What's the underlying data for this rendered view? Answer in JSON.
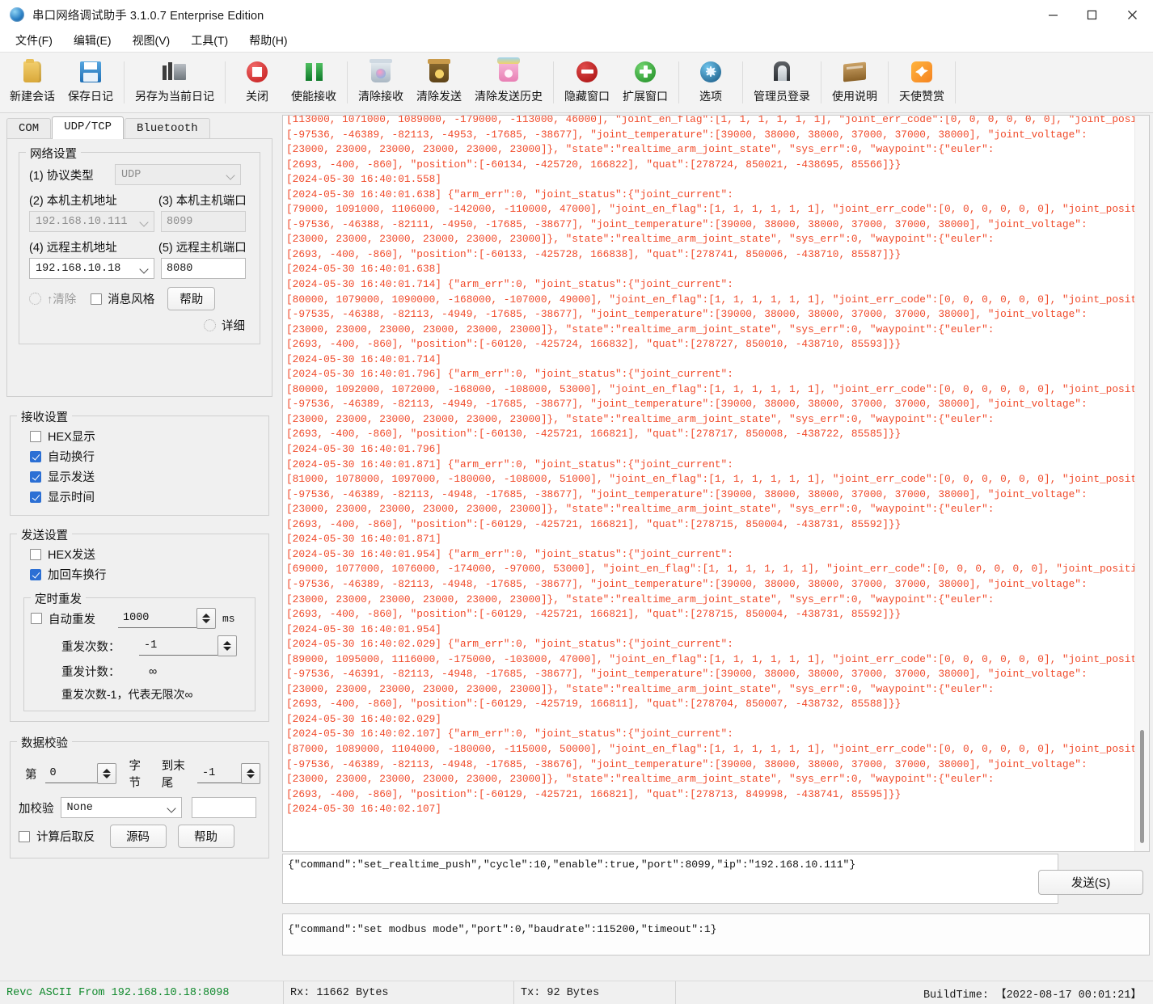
{
  "window": {
    "title": "串口网络调试助手 3.1.0.7 Enterprise Edition",
    "minimize": "—",
    "maximize": "☐",
    "close": "✕"
  },
  "menu": [
    {
      "label": "文件(F)"
    },
    {
      "label": "编辑(E)"
    },
    {
      "label": "视图(V)"
    },
    {
      "label": "工具(T)"
    },
    {
      "label": "帮助(H)"
    }
  ],
  "toolbar": [
    {
      "label": "新建会话",
      "icon": "folder-icon"
    },
    {
      "label": "保存日记",
      "icon": "floppy-disk-icon"
    },
    {
      "label": "另存为当前日记",
      "icon": "save-as-icon"
    },
    {
      "label": "关闭",
      "icon": "stop-icon"
    },
    {
      "label": "使能接收",
      "icon": "pause-icon"
    },
    {
      "label": "清除接收",
      "icon": "trash-bin-icon"
    },
    {
      "label": "清除发送",
      "icon": "recycle-bin-brown-icon"
    },
    {
      "label": "清除发送历史",
      "icon": "recycle-basket-pink-icon"
    },
    {
      "label": "隐藏窗口",
      "icon": "no-entry-icon"
    },
    {
      "label": "扩展窗口",
      "icon": "plus-circle-icon"
    },
    {
      "label": "选项",
      "icon": "gear-globe-icon"
    },
    {
      "label": "管理员登录",
      "icon": "door-login-icon"
    },
    {
      "label": "使用说明",
      "icon": "book-icon"
    },
    {
      "label": "天使赞赏",
      "icon": "angel-donate-icon"
    }
  ],
  "tabs": [
    {
      "label": "COM",
      "active": false
    },
    {
      "label": "UDP/TCP",
      "active": true
    },
    {
      "label": "Bluetooth",
      "active": false
    }
  ],
  "network": {
    "group_label": "网络设置",
    "protocol_label": "(1) 协议类型",
    "protocol_value": "UDP",
    "local_addr_label": "(2) 本机主机地址",
    "local_port_label": "(3) 本机主机端口",
    "local_addr_value": "192.168.10.111",
    "local_port_value": "8099",
    "remote_addr_label": "(4) 远程主机地址",
    "remote_port_label": "(5) 远程主机端口",
    "remote_addr_value": "192.168.10.18",
    "remote_port_value": "8080",
    "clear_label": "↑清除",
    "msg_style_label": "消息风格",
    "help_label": "帮助",
    "detail_label": "详细"
  },
  "receive": {
    "group_label": "接收设置",
    "items": [
      {
        "label": "HEX显示",
        "checked": false
      },
      {
        "label": "自动换行",
        "checked": true
      },
      {
        "label": "显示发送",
        "checked": true
      },
      {
        "label": "显示时间",
        "checked": true
      }
    ]
  },
  "send": {
    "group_label": "发送设置",
    "items": [
      {
        "label": "HEX发送",
        "checked": false
      },
      {
        "label": "加回车换行",
        "checked": true
      }
    ],
    "timer_group_label": "定时重发",
    "auto_resend_label": "自动重发",
    "auto_resend_checked": false,
    "interval_value": "1000",
    "interval_unit": "ms",
    "resend_count_label": "重发次数：",
    "resend_count_value": "-1",
    "resend_counter_label": "重发计数：",
    "resend_counter_value": "∞",
    "hint": "重发次数-1，代表无限次∞"
  },
  "checksum": {
    "group_label": "数据校验",
    "from_label": "第",
    "from_value": "0",
    "byte_label": "字节",
    "to_label": "到末尾",
    "to_value": "-1",
    "add_check_label": "加校验",
    "add_check_value": "None",
    "extra_value": "",
    "invert_label": "计算后取反",
    "invert_checked": false,
    "source_label": "源码",
    "help_label": "帮助"
  },
  "log": {
    "text": "[113000, 1071000, 1089000, -179000, -113000, 46000], \"joint_en_flag\":[1, 1, 1, 1, 1, 1], \"joint_err_code\":[0, 0, 0, 0, 0, 0], \"joint_position\":\n[-97536, -46389, -82113, -4953, -17685, -38677], \"joint_temperature\":[39000, 38000, 38000, 37000, 37000, 38000], \"joint_voltage\":\n[23000, 23000, 23000, 23000, 23000, 23000]}, \"state\":\"realtime_arm_joint_state\", \"sys_err\":0, \"waypoint\":{\"euler\":\n[2693, -400, -860], \"position\":[-60134, -425720, 166822], \"quat\":[278724, 850021, -438695, 85566]}}\n[2024-05-30 16:40:01.558]\n[2024-05-30 16:40:01.638] {\"arm_err\":0, \"joint_status\":{\"joint_current\":\n[79000, 1091000, 1106000, -142000, -110000, 47000], \"joint_en_flag\":[1, 1, 1, 1, 1, 1], \"joint_err_code\":[0, 0, 0, 0, 0, 0], \"joint_position\":\n[-97536, -46388, -82111, -4950, -17685, -38677], \"joint_temperature\":[39000, 38000, 38000, 37000, 37000, 38000], \"joint_voltage\":\n[23000, 23000, 23000, 23000, 23000, 23000]}, \"state\":\"realtime_arm_joint_state\", \"sys_err\":0, \"waypoint\":{\"euler\":\n[2693, -400, -860], \"position\":[-60133, -425728, 166838], \"quat\":[278741, 850006, -438710, 85587]}}\n[2024-05-30 16:40:01.638]\n[2024-05-30 16:40:01.714] {\"arm_err\":0, \"joint_status\":{\"joint_current\":\n[80000, 1079000, 1090000, -168000, -107000, 49000], \"joint_en_flag\":[1, 1, 1, 1, 1, 1], \"joint_err_code\":[0, 0, 0, 0, 0, 0], \"joint_position\":\n[-97535, -46388, -82113, -4949, -17685, -38677], \"joint_temperature\":[39000, 38000, 38000, 37000, 37000, 38000], \"joint_voltage\":\n[23000, 23000, 23000, 23000, 23000, 23000]}, \"state\":\"realtime_arm_joint_state\", \"sys_err\":0, \"waypoint\":{\"euler\":\n[2693, -400, -860], \"position\":[-60120, -425724, 166832], \"quat\":[278727, 850010, -438710, 85593]}}\n[2024-05-30 16:40:01.714]\n[2024-05-30 16:40:01.796] {\"arm_err\":0, \"joint_status\":{\"joint_current\":\n[80000, 1092000, 1072000, -168000, -108000, 53000], \"joint_en_flag\":[1, 1, 1, 1, 1, 1], \"joint_err_code\":[0, 0, 0, 0, 0, 0], \"joint_position\":\n[-97536, -46389, -82113, -4949, -17685, -38677], \"joint_temperature\":[39000, 38000, 38000, 37000, 37000, 38000], \"joint_voltage\":\n[23000, 23000, 23000, 23000, 23000, 23000]}, \"state\":\"realtime_arm_joint_state\", \"sys_err\":0, \"waypoint\":{\"euler\":\n[2693, -400, -860], \"position\":[-60130, -425721, 166821], \"quat\":[278717, 850008, -438722, 85585]}}\n[2024-05-30 16:40:01.796]\n[2024-05-30 16:40:01.871] {\"arm_err\":0, \"joint_status\":{\"joint_current\":\n[81000, 1078000, 1097000, -180000, -108000, 51000], \"joint_en_flag\":[1, 1, 1, 1, 1, 1], \"joint_err_code\":[0, 0, 0, 0, 0, 0], \"joint_position\":\n[-97536, -46389, -82113, -4948, -17685, -38677], \"joint_temperature\":[39000, 38000, 38000, 37000, 37000, 38000], \"joint_voltage\":\n[23000, 23000, 23000, 23000, 23000, 23000]}, \"state\":\"realtime_arm_joint_state\", \"sys_err\":0, \"waypoint\":{\"euler\":\n[2693, -400, -860], \"position\":[-60129, -425721, 166821], \"quat\":[278715, 850004, -438731, 85592]}}\n[2024-05-30 16:40:01.871]\n[2024-05-30 16:40:01.954] {\"arm_err\":0, \"joint_status\":{\"joint_current\":\n[69000, 1077000, 1076000, -174000, -97000, 53000], \"joint_en_flag\":[1, 1, 1, 1, 1, 1], \"joint_err_code\":[0, 0, 0, 0, 0, 0], \"joint_position\":\n[-97536, -46389, -82113, -4948, -17685, -38677], \"joint_temperature\":[39000, 38000, 38000, 37000, 37000, 38000], \"joint_voltage\":\n[23000, 23000, 23000, 23000, 23000, 23000]}, \"state\":\"realtime_arm_joint_state\", \"sys_err\":0, \"waypoint\":{\"euler\":\n[2693, -400, -860], \"position\":[-60129, -425721, 166821], \"quat\":[278715, 850004, -438731, 85592]}}\n[2024-05-30 16:40:01.954]\n[2024-05-30 16:40:02.029] {\"arm_err\":0, \"joint_status\":{\"joint_current\":\n[89000, 1095000, 1116000, -175000, -103000, 47000], \"joint_en_flag\":[1, 1, 1, 1, 1, 1], \"joint_err_code\":[0, 0, 0, 0, 0, 0], \"joint_position\":\n[-97536, -46391, -82113, -4948, -17685, -38677], \"joint_temperature\":[39000, 38000, 38000, 37000, 37000, 38000], \"joint_voltage\":\n[23000, 23000, 23000, 23000, 23000, 23000]}, \"state\":\"realtime_arm_joint_state\", \"sys_err\":0, \"waypoint\":{\"euler\":\n[2693, -400, -860], \"position\":[-60129, -425719, 166811], \"quat\":[278704, 850007, -438732, 85588]}}\n[2024-05-30 16:40:02.029]\n[2024-05-30 16:40:02.107] {\"arm_err\":0, \"joint_status\":{\"joint_current\":\n[87000, 1089000, 1104000, -180000, -115000, 50000], \"joint_en_flag\":[1, 1, 1, 1, 1, 1], \"joint_err_code\":[0, 0, 0, 0, 0, 0], \"joint_position\":\n[-97536, -46389, -82113, -4948, -17685, -38676], \"joint_temperature\":[39000, 38000, 38000, 37000, 37000, 38000], \"joint_voltage\":\n[23000, 23000, 23000, 23000, 23000, 23000]}, \"state\":\"realtime_arm_joint_state\", \"sys_err\":0, \"waypoint\":{\"euler\":\n[2693, -400, -860], \"position\":[-60129, -425721, 166821], \"quat\":[278713, 849998, -438741, 85595]}}\n[2024-05-30 16:40:02.107]"
  },
  "compose": {
    "value": "{\"command\":\"set_realtime_push\",\"cycle\":10,\"enable\":true,\"port\":8099,\"ip\":\"192.168.10.111\"}",
    "send_button": "发送(S)"
  },
  "history": {
    "items": [
      "{\"command\":\"set modbus mode\",\"port\":0,\"baudrate\":115200,\"timeout\":1}"
    ]
  },
  "statusbar": {
    "recv": "Revc ASCII From 192.168.10.18:8098",
    "rx": "Rx: 11662 Bytes",
    "tx": "Tx: 92 Bytes",
    "build": "BuildTime: 【2022-08-17 00:01:21】"
  },
  "colors": {
    "log_text": "#f04a2a",
    "status_recv": "#128a2e",
    "checkbox_on": "#2b6fd4"
  }
}
